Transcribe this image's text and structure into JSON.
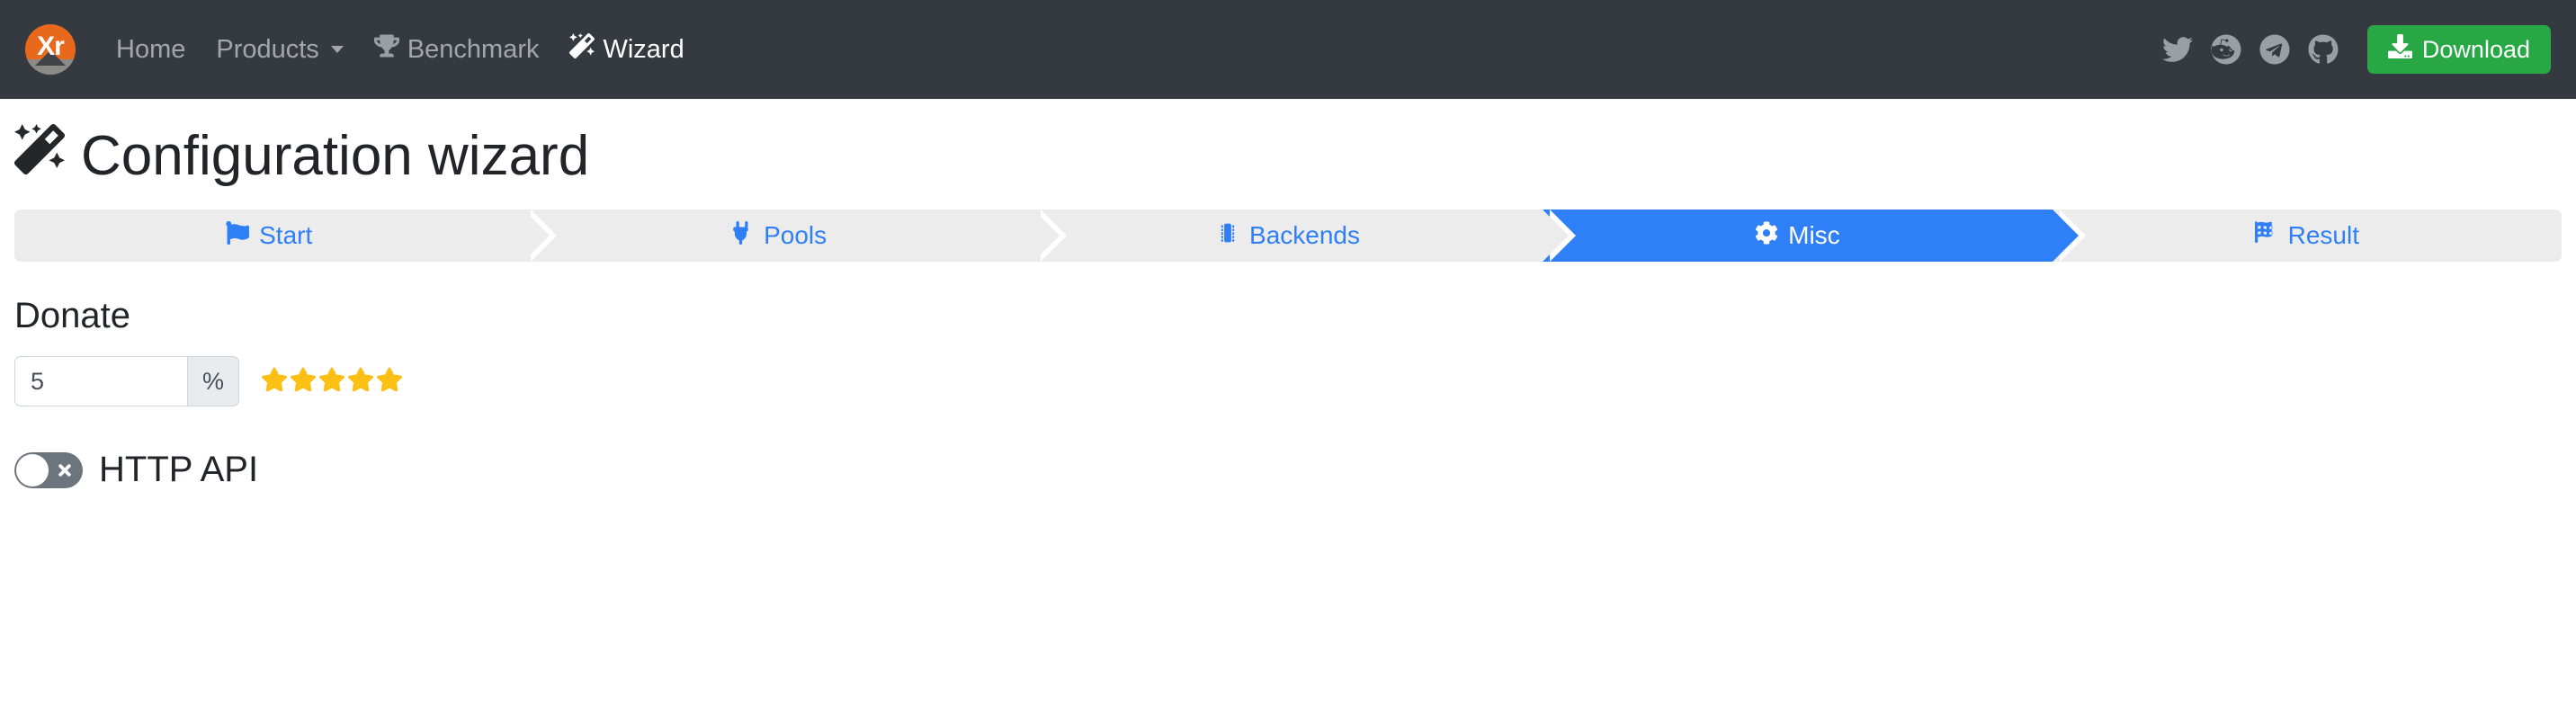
{
  "navbar": {
    "brand": {
      "text": "Xr",
      "icon": "xr-logo-icon",
      "bg": "#e8681c"
    },
    "links": [
      {
        "label": "Home",
        "icon": null,
        "active": false
      },
      {
        "label": "Products",
        "icon": "chevron-down-icon",
        "active": false
      },
      {
        "label": "Benchmark",
        "icon": "trophy-icon",
        "active": false
      },
      {
        "label": "Wizard",
        "icon": "magic-wand-icon",
        "active": true
      }
    ],
    "social": [
      {
        "name": "twitter-icon"
      },
      {
        "name": "reddit-icon"
      },
      {
        "name": "telegram-icon"
      },
      {
        "name": "github-icon"
      }
    ],
    "download": {
      "label": "Download",
      "icon": "download-icon",
      "color": "#28a745"
    },
    "bg": "#343a40"
  },
  "page": {
    "title": "Configuration wizard",
    "title_icon": "magic-wand-icon"
  },
  "steps": [
    {
      "label": "Start",
      "icon": "flag-icon",
      "active": false
    },
    {
      "label": "Pools",
      "icon": "plug-icon",
      "active": false
    },
    {
      "label": "Backends",
      "icon": "memory-chip-icon",
      "active": false
    },
    {
      "label": "Misc",
      "icon": "gear-icon",
      "active": true
    },
    {
      "label": "Result",
      "icon": "checkered-flag-icon",
      "active": false
    }
  ],
  "donate": {
    "title": "Donate",
    "value": "5",
    "placeholder": "",
    "unit": "%",
    "stars_filled": 5,
    "star_color": "#fcc014"
  },
  "http_api": {
    "label": "HTTP API",
    "enabled": false,
    "off_icon": "x-mark-icon"
  },
  "theme": {
    "accent": "#2f7ff7",
    "step_bg": "#ececec",
    "navbar_bg": "#343a40"
  }
}
